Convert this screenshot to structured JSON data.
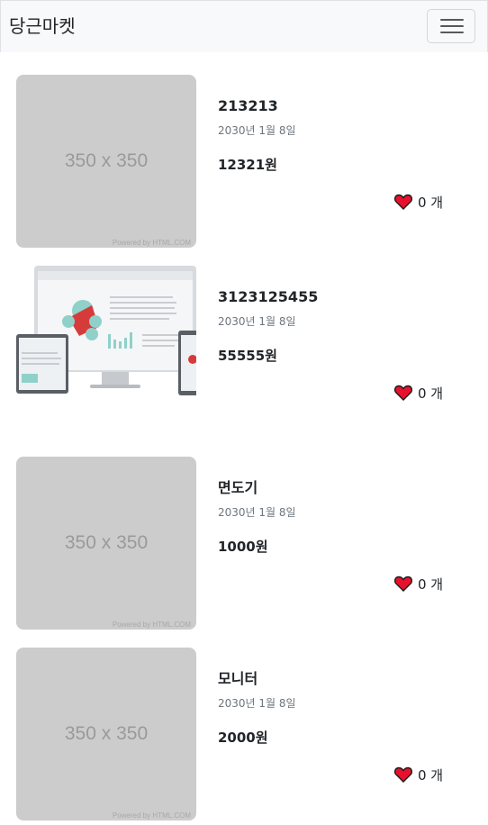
{
  "navbar": {
    "brand": "당근마켓",
    "toggle_icon": "hamburger-icon"
  },
  "placeholder": {
    "label": "350 x 350",
    "credit": "Powered by HTML.COM"
  },
  "products": [
    {
      "title": "213213",
      "date": "2030년 1월 8일",
      "price": "12321원",
      "likes": "0 개",
      "image": "placeholder"
    },
    {
      "title": "3123125455",
      "date": "2030년 1월 8일",
      "price": "55555원",
      "likes": "0 개",
      "image": "devices-photo"
    },
    {
      "title": "면도기",
      "date": "2030년 1월 8일",
      "price": "1000원",
      "likes": "0 개",
      "image": "placeholder"
    },
    {
      "title": "모니터",
      "date": "2030년 1월 8일",
      "price": "2000원",
      "likes": "0 개",
      "image": "placeholder"
    }
  ],
  "colors": {
    "heart": "#e8112d",
    "navbar_bg": "#f8f9fa",
    "placeholder_bg": "#cccccc"
  }
}
